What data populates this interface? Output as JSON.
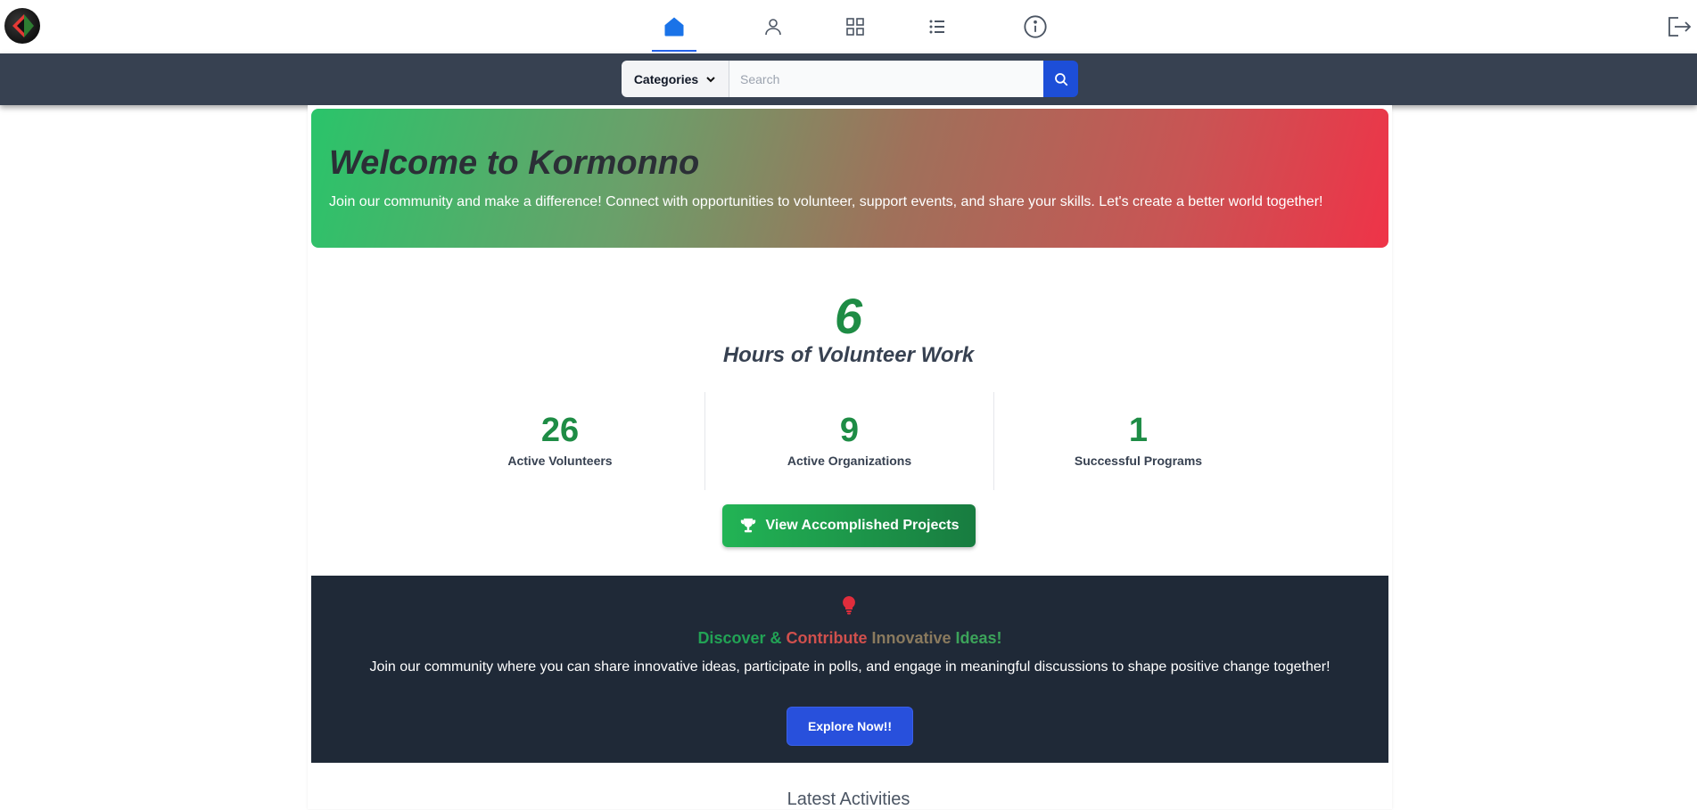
{
  "nav": {
    "items": [
      {
        "name": "home",
        "active": true
      },
      {
        "name": "profile",
        "active": false
      },
      {
        "name": "dashboard",
        "active": false
      },
      {
        "name": "list",
        "active": false
      },
      {
        "name": "info",
        "active": false
      }
    ]
  },
  "search": {
    "categories_label": "Categories",
    "placeholder": "Search"
  },
  "hero": {
    "title": "Welcome to Kormonno",
    "text": "Join our community and make a difference! Connect with opportunities to volunteer, support events, and share your skills. Let's create a better world together!"
  },
  "hours": {
    "value": "6",
    "label": "Hours of Volunteer Work"
  },
  "stats": [
    {
      "value": "26",
      "label": "Active Volunteers"
    },
    {
      "value": "9",
      "label": "Active Organizations"
    },
    {
      "value": "1",
      "label": "Successful Programs"
    }
  ],
  "projects_button": "View Accomplished Projects",
  "ideas": {
    "title_part1": "Discover & ",
    "title_part2": "Contribute ",
    "title_part3": "Innovative ",
    "title_part4": "Ideas!",
    "text": "Join our community where you can share innovative ideas, participate in polls, and engage in meaningful discussions to shape positive change together!",
    "button": "Explore Now!!"
  },
  "latest_heading": "Latest Activities",
  "colors": {
    "accent_blue": "#2563eb",
    "green": "#1e8c45",
    "dark_band": "#1f2937",
    "nav_band": "#374151"
  }
}
